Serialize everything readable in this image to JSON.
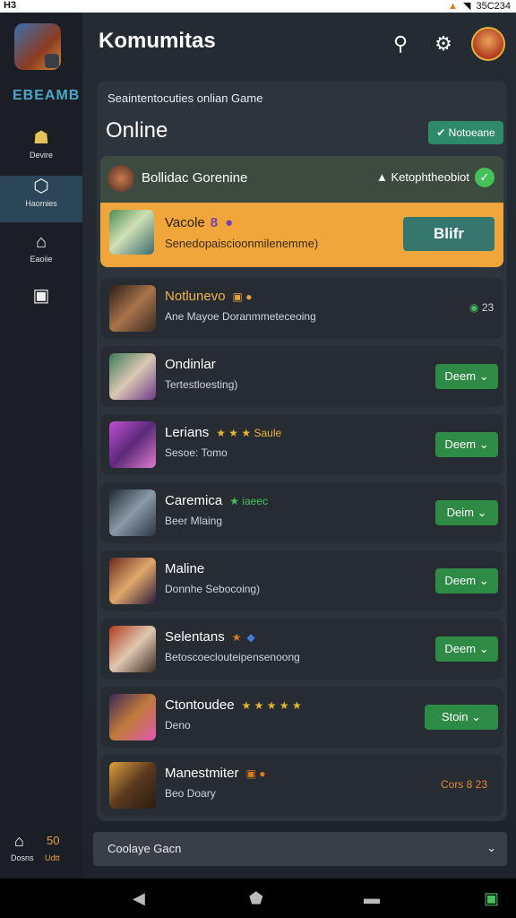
{
  "statusbar": {
    "left": "H3",
    "right": "35C234"
  },
  "sidebar": {
    "logo_text": "EBEAMB",
    "items": [
      {
        "label": "Devire",
        "icon": "gamepad-icon"
      },
      {
        "label": "Haomies",
        "icon": "hex-icon"
      },
      {
        "label": "Eaoiie",
        "icon": "home-icon"
      },
      {
        "label": "",
        "icon": "window-icon"
      }
    ],
    "bottom_label_left": "Dosns",
    "bottom_label_right": "Udtt",
    "bottom_count": "50"
  },
  "header": {
    "title": "Komumitas"
  },
  "panel": {
    "subtitle": "Seaintentocuties onlian Game",
    "online_title": "Online",
    "top_button": "Notoeane"
  },
  "featured": {
    "top_name": "Bollidac Gorenine",
    "top_meta": "Ketophtheobiot",
    "main_name": "Vacole",
    "main_badge": "8",
    "main_sub": "Senedopaiscioonmilenemme)",
    "main_button": "Blifr"
  },
  "rows": [
    {
      "name": "Notlunevo",
      "extra": "",
      "sub": "Ane Mayoe Doranmmeteceoing",
      "right_kind": "stat",
      "right_value": "23"
    },
    {
      "name": "Ondinlar",
      "extra": "",
      "sub": "Tertestloesting)",
      "right_kind": "button",
      "right_value": "Deem"
    },
    {
      "name": "Lerians",
      "extra": "★ ★ ★ Saule",
      "sub": "Sesoe: Tomo",
      "right_kind": "button",
      "right_value": "Deem"
    },
    {
      "name": "Caremica",
      "extra": "★ iaeec",
      "sub": "Beer Mlaing",
      "right_kind": "button",
      "right_value": "Deim"
    },
    {
      "name": "Maline",
      "extra": "",
      "sub": "Donnhe Sebocoing)",
      "right_kind": "button",
      "right_value": "Deem"
    },
    {
      "name": "Selentans",
      "extra": "★",
      "sub": "Betoscoeclouteipensenoong",
      "right_kind": "button",
      "right_value": "Deem"
    },
    {
      "name": "Ctontoudee",
      "extra": "★ ★ ★ ★ ★",
      "sub": "Deno",
      "right_kind": "button",
      "right_value": "Stoin"
    },
    {
      "name": "Manestmiter",
      "extra": "",
      "sub": "Beo Doary",
      "right_kind": "stat2",
      "right_value": "Cors 8 23"
    }
  ],
  "bottom_bar": {
    "label": "Coolaye Gacn"
  },
  "colors": {
    "accent_green": "#2e8b45",
    "featured_orange": "#f0a63b",
    "teal": "#35766f"
  }
}
